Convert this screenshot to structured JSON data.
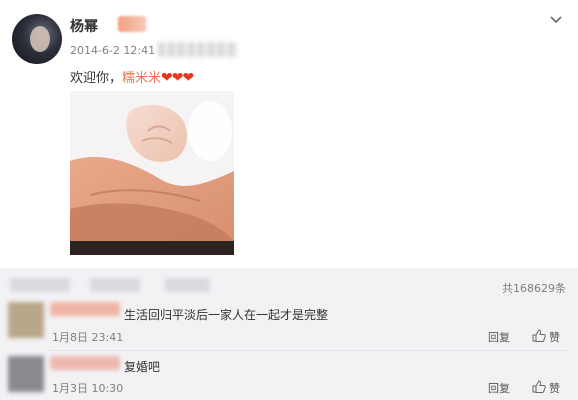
{
  "post": {
    "author": "杨幂",
    "timestamp": "2014-6-2 12:41",
    "text_prefix": "欢迎你，",
    "mention": "糯米米",
    "hearts": "❤❤❤"
  },
  "comments_header": {
    "total": "共168629条"
  },
  "comments": [
    {
      "text": "生活回归平淡后一家人在一起才是完整",
      "time": "1月8日 23:41",
      "reply": "回复",
      "like": "赞"
    },
    {
      "text": "复婚吧",
      "time": "1月3日 10:30",
      "reply": "回复",
      "like": "赞"
    }
  ],
  "colors": {
    "mention": "#eb7350",
    "hearts": "#e8361f",
    "comment_bg": "#f2f2f5"
  }
}
